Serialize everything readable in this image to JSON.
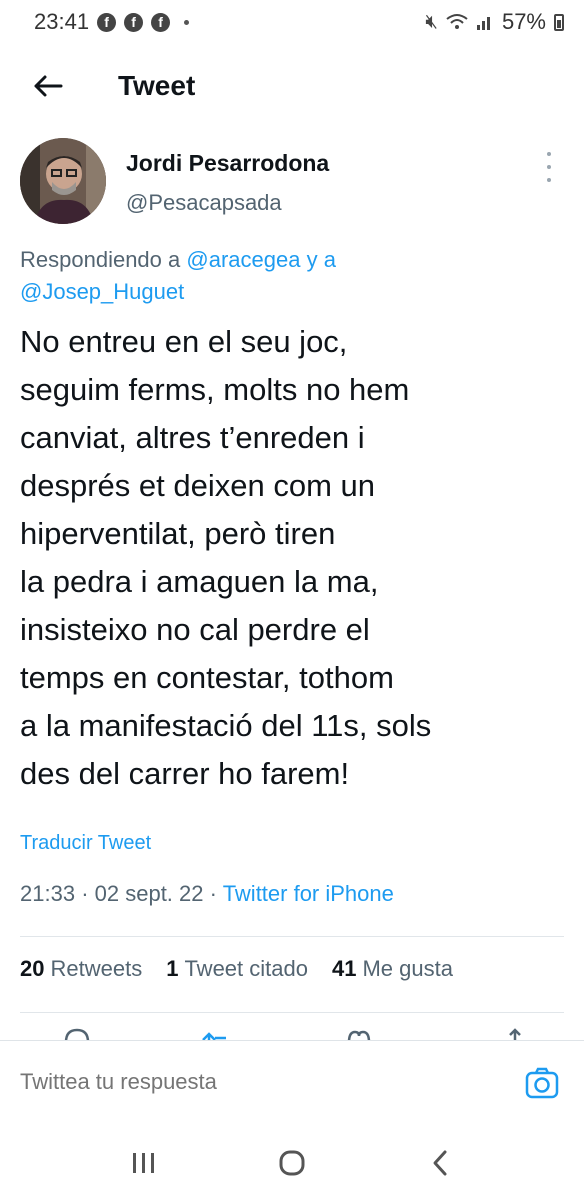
{
  "status_bar": {
    "time": "23:41",
    "notification_icons": [
      "facebook-icon",
      "facebook-icon",
      "facebook-icon"
    ],
    "battery": "57%"
  },
  "app_bar": {
    "title": "Tweet",
    "back_icon": "back-arrow-icon"
  },
  "tweet": {
    "author_name": "Jordi Pesarrodona",
    "author_handle": "@Pesacapsada",
    "reply_prefix": "Respondiendo a",
    "reply_mention_1": "@aracegea",
    "reply_joiner": "y a",
    "reply_mention_2": "@Josep_Huguet",
    "text_lines": [
      "No entreu en el seu joc,",
      "seguim ferms, molts no hem",
      "canviat, altres t’enreden i",
      "després et deixen com un",
      "hiperventilat, però tiren",
      "la pedra i amaguen la ma,",
      "insisteixo no cal perdre el",
      "temps en contestar, tothom",
      "a la manifestació del 11s, sols",
      "des del carrer ho farem!"
    ],
    "translate_label": "Traducir Tweet",
    "time": "21:33",
    "date": "02 sept. 22",
    "source": "Twitter for iPhone",
    "separator": "·"
  },
  "stats": {
    "retweets_count": "20",
    "retweets_label": "Retweets",
    "quotes_count": "1",
    "quotes_label": "Tweet citado",
    "likes_count": "41",
    "likes_label": "Me gusta"
  },
  "composer": {
    "placeholder": "Twittea tu respuesta",
    "camera_icon": "camera-icon"
  },
  "nav_bar": [
    "recents-icon",
    "home-icon",
    "back-icon"
  ],
  "colors": {
    "accent": "#1d9bf0",
    "text": "#0f1419",
    "secondary": "#536471"
  }
}
